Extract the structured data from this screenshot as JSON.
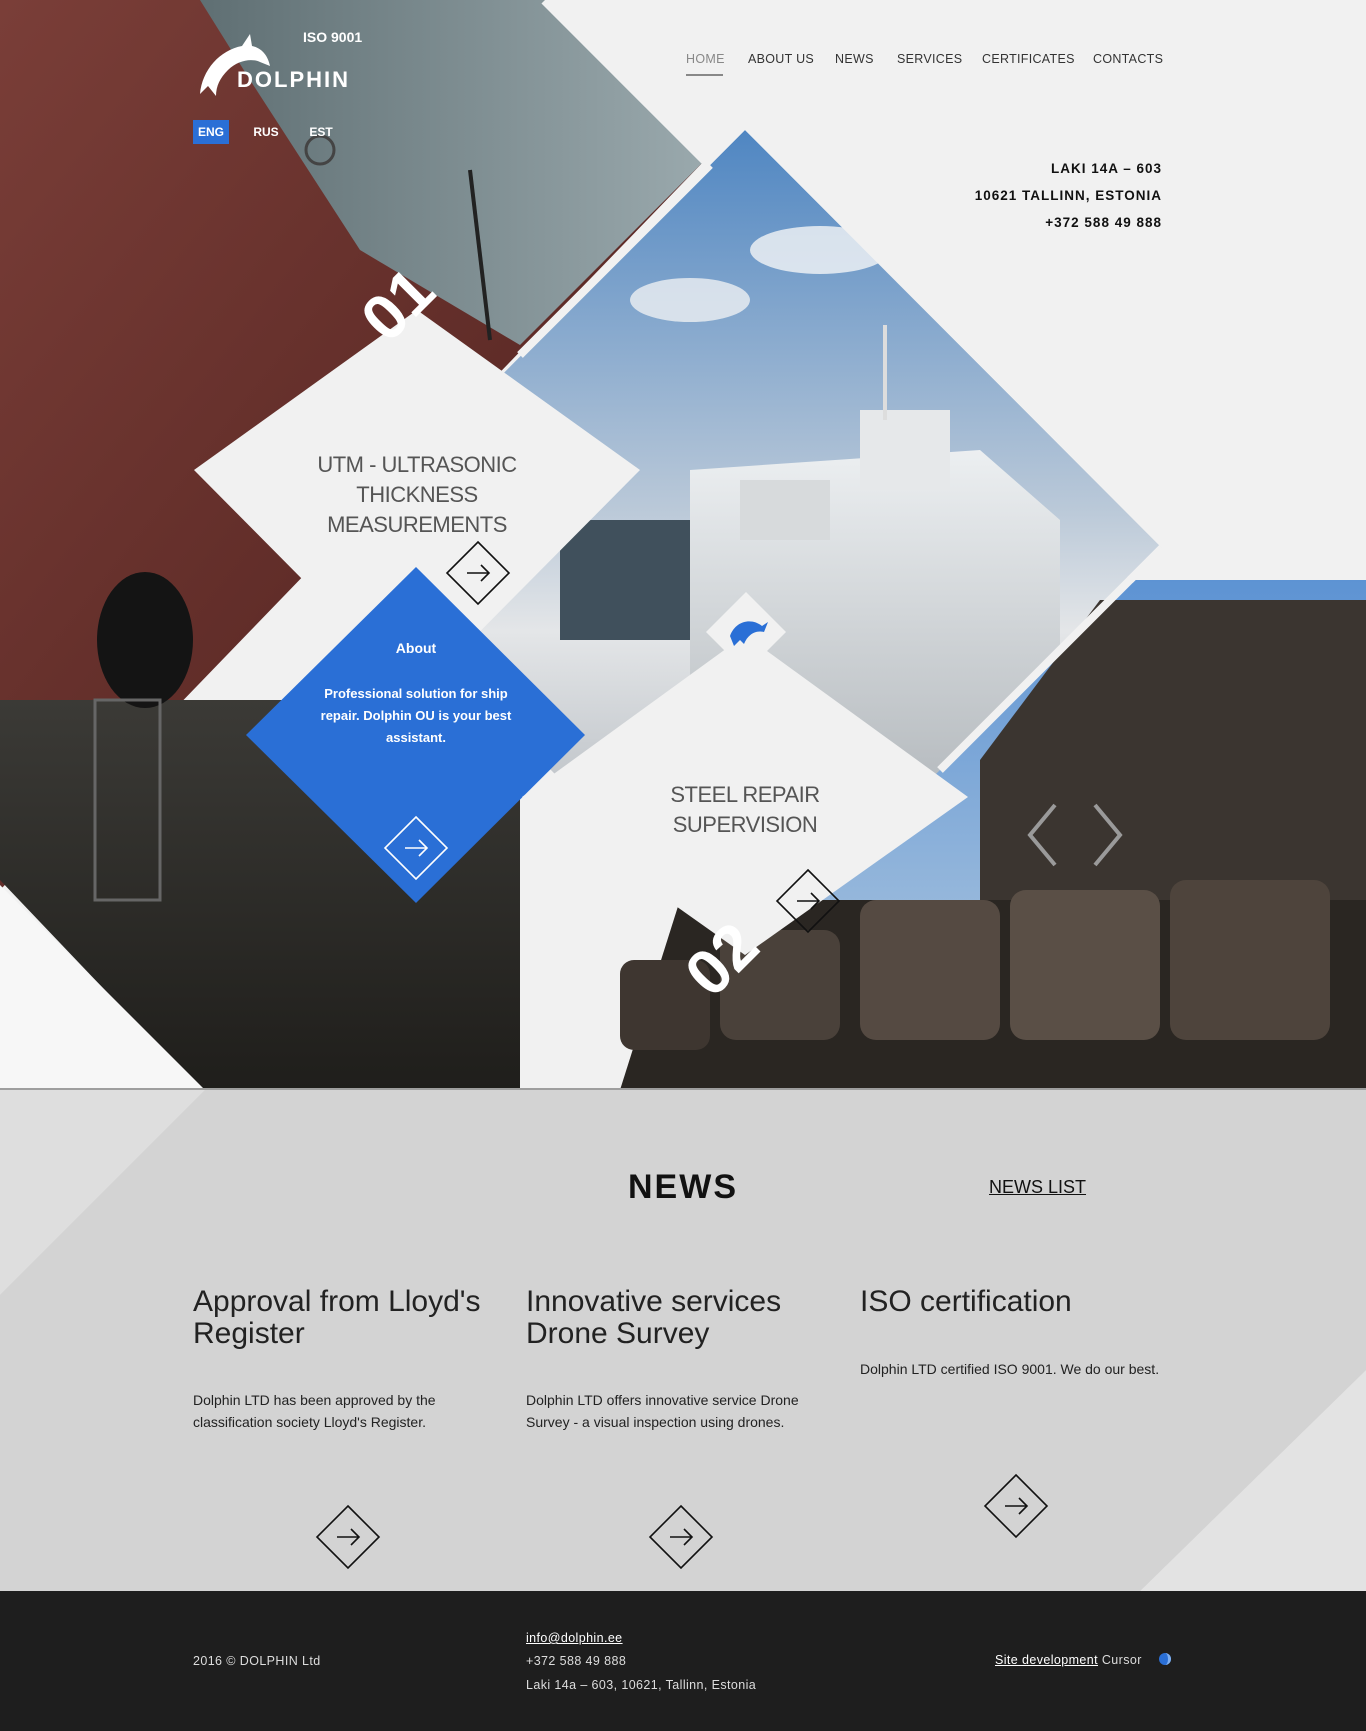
{
  "header": {
    "iso_label": "ISO 9001",
    "brand": "DOLPHIN",
    "languages": [
      {
        "label": "ENG",
        "active": true
      },
      {
        "label": "RUS",
        "active": false
      },
      {
        "label": "EST",
        "active": false
      }
    ],
    "nav": [
      {
        "label": "HOME",
        "active": true
      },
      {
        "label": "ABOUT US",
        "active": false
      },
      {
        "label": "NEWS",
        "active": false
      },
      {
        "label": "SERVICES",
        "active": false
      },
      {
        "label": "CERTIFICATES",
        "active": false
      },
      {
        "label": "CONTACTS",
        "active": false
      }
    ],
    "address": [
      "LAKI 14A – 603",
      "10621 TALLINN, ESTONIA",
      "+372 588 49 888"
    ]
  },
  "hero": {
    "number_1": "01",
    "number_2": "02",
    "service_1": [
      "UTM - ULTRASONIC",
      "THICKNESS",
      "MEASUREMENTS"
    ],
    "service_2": [
      "STEEL REPAIR",
      "SUPERVISION"
    ],
    "about_title": "About",
    "about_text": "Professional solution for ship repair. Dolphin OU is your best assistant."
  },
  "news": {
    "heading": "NEWS",
    "list_link": "NEWS LIST",
    "items": [
      {
        "title": "Approval from Lloyd's Register",
        "text": "Dolphin LTD has been approved by the classification society Lloyd's Register."
      },
      {
        "title": "Innovative services Drone Survey",
        "text": "Dolphin LTD offers innovative service Drone Survey - a visual inspection using drones."
      },
      {
        "title": "ISO certification",
        "text": "Dolphin LTD certified ISO 9001. We do our best."
      }
    ]
  },
  "footer": {
    "copyright": "2016 © DOLPHIN Ltd",
    "email": "info@dolphin.ee",
    "phone": "+372 588 49 888",
    "address": "Laki 14a – 603, 10621, Tallinn, Estonia",
    "dev_link": "Site development",
    "dev_name": "Cursor"
  },
  "colors": {
    "accent": "#2a6fd6",
    "panel": "#f1f1f1",
    "news_bg": "#d3d3d3",
    "footer_bg": "#1e1e1e"
  }
}
